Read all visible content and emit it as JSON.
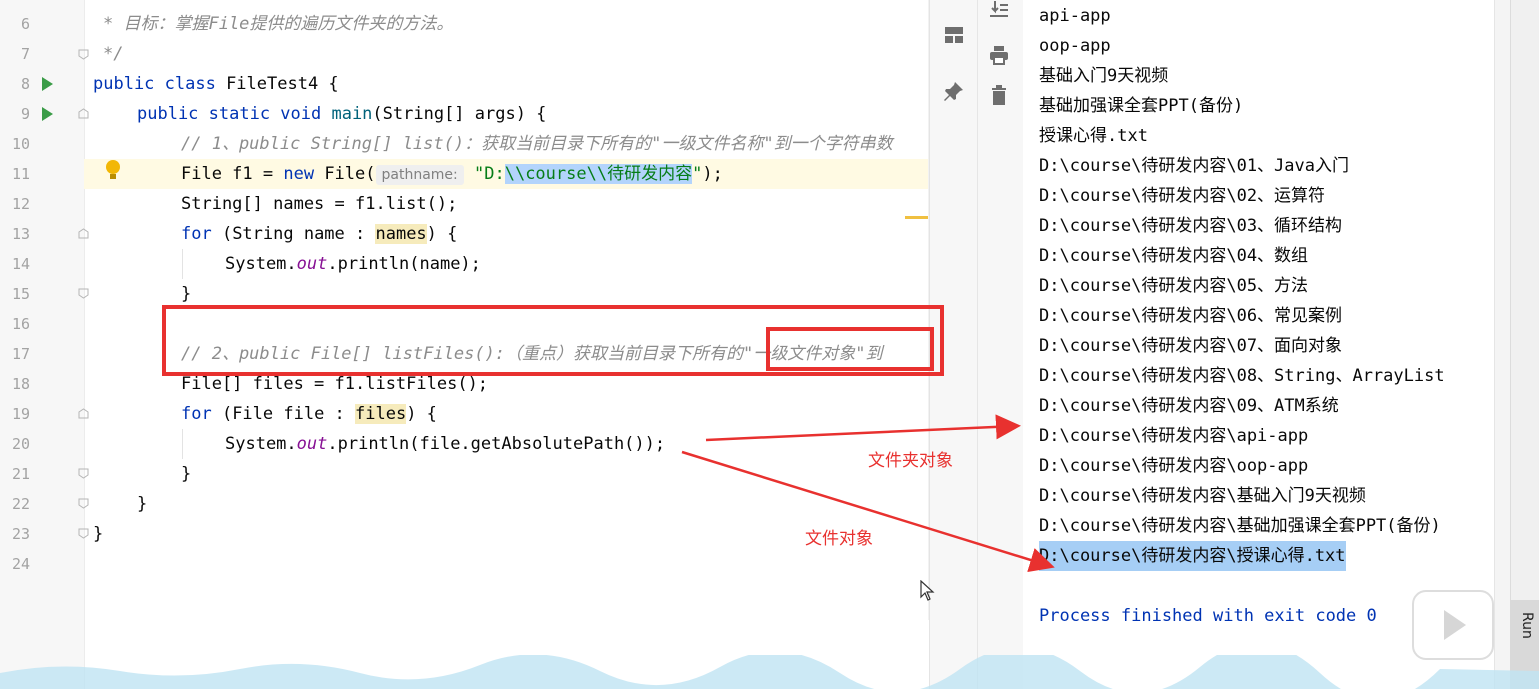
{
  "editor": {
    "line_numbers": [
      "6",
      "7",
      "8",
      "9",
      "10",
      "11",
      "12",
      "13",
      "14",
      "15",
      "16",
      "17",
      "18",
      "19",
      "20",
      "21",
      "22",
      "23",
      "24"
    ],
    "lines": {
      "l6": "* 目标：掌握File提供的遍历文件夹的方法。",
      "l7": "*/",
      "l8_kw": "public class",
      "l8_rest": " FileTest4 {",
      "l9_kw": "public static void",
      "l9_method": " main",
      "l9_rest": "(String[] args) {",
      "l10": "// 1、public String[] list()：获取当前目录下所有的\"一级文件名称\"到一个字符串数",
      "l11_a": "File f1 = ",
      "l11_kw": "new",
      "l11_b": " File(",
      "l11_hint": "pathname:",
      "l11_str_a": "\"D:",
      "l11_str_sel": "\\\\course\\\\待研发内容",
      "l11_str_b": "\"",
      "l11_end": ");",
      "l12": "String[] names = f1.list();",
      "l13_kw": "for",
      "l13_a": " (String name : ",
      "l13_use": "names",
      "l13_b": ") {",
      "l14_a": "System.",
      "l14_fld": "out",
      "l14_b": ".println(name);",
      "l15": "}",
      "l17": "// 2、public File[] listFiles():（重点）获取当前目录下所有的\"一级文件对象\"到",
      "l18": "File[] files = f1.listFiles();",
      "l19_kw": "for",
      "l19_a": " (File file : ",
      "l19_use": "files",
      "l19_b": ") {",
      "l20_a": "System.",
      "l20_fld": "out",
      "l20_b": ".println(file.getAbsolutePath());",
      "l21": "}",
      "l22": "}",
      "l23": "}"
    }
  },
  "console": {
    "lines": [
      "api-app",
      "oop-app",
      "基础入门9天视频",
      "基础加强课全套PPT(备份)",
      "授课心得.txt",
      "D:\\course\\待研发内容\\01、Java入门",
      "D:\\course\\待研发内容\\02、运算符",
      "D:\\course\\待研发内容\\03、循环结构",
      "D:\\course\\待研发内容\\04、数组",
      "D:\\course\\待研发内容\\05、方法",
      "D:\\course\\待研发内容\\06、常见案例",
      "D:\\course\\待研发内容\\07、面向对象",
      "D:\\course\\待研发内容\\08、String、ArrayList",
      "D:\\course\\待研发内容\\09、ATM系统",
      "D:\\course\\待研发内容\\api-app",
      "D:\\course\\待研发内容\\oop-app",
      "D:\\course\\待研发内容\\基础入门9天视频",
      "D:\\course\\待研发内容\\基础加强课全套PPT(备份)",
      "D:\\course\\待研发内容\\授课心得.txt"
    ],
    "process_finished": "Process finished with exit code 0"
  },
  "annotations": {
    "folder_object": "文件夹对象",
    "file_object": "文件对象"
  },
  "side_tab": {
    "run_label": "Run"
  },
  "colors": {
    "annotation": "#e8312f",
    "keyword": "#0033b3",
    "string": "#067d17",
    "comment": "#8c8c8c"
  }
}
